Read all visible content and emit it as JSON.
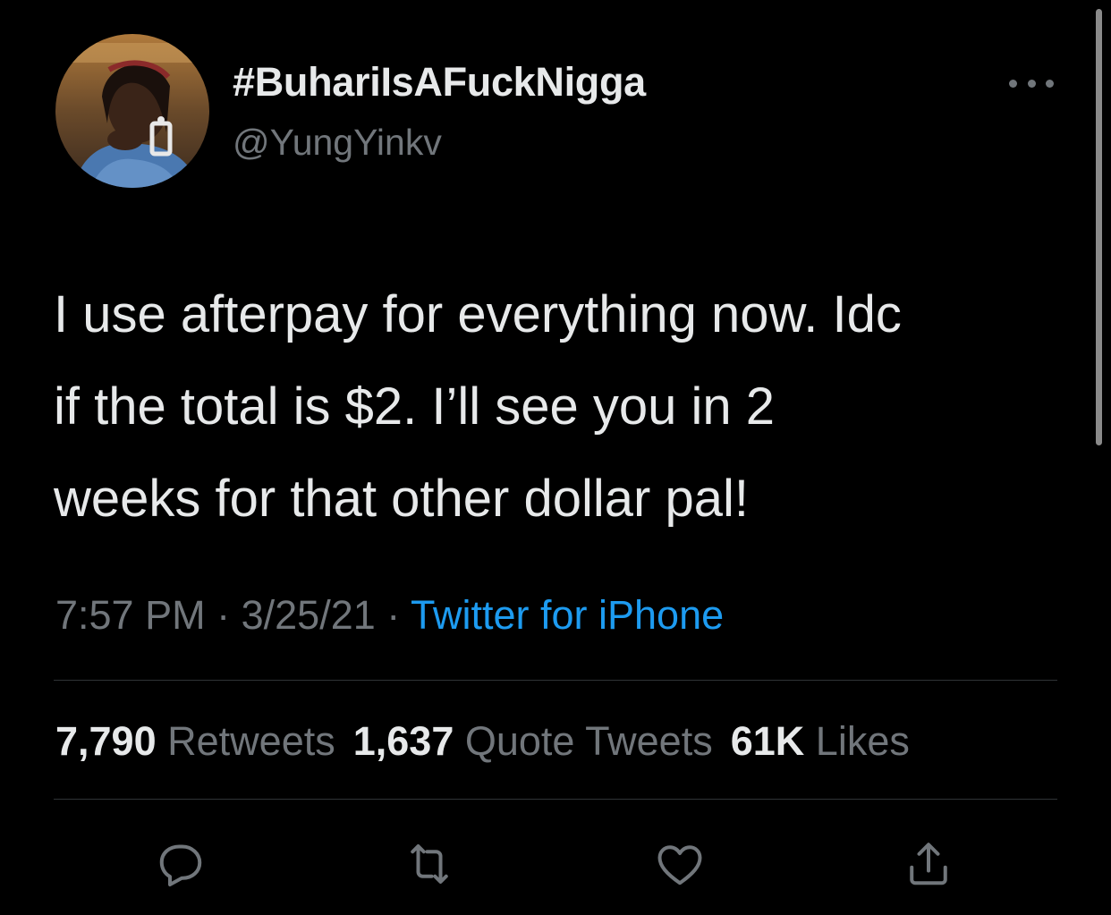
{
  "tweet": {
    "display_name": "#BuhariIsAFuckNigga",
    "handle": "@YungYinkv",
    "text_lines": [
      "I use afterpay for everything now. Idc",
      "if the total is $2. I’ll see you in 2",
      "weeks for that other dollar pal!"
    ],
    "time": "7:57 PM",
    "date": "3/25/21",
    "separator": "·",
    "source": "Twitter for iPhone",
    "stats": {
      "retweets_count": "7,790",
      "retweets_label": "Retweets",
      "quotes_count": "1,637",
      "quotes_label": "Quote Tweets",
      "likes_count": "61K",
      "likes_label": "Likes"
    }
  },
  "icons": {
    "more": "more-icon",
    "reply": "reply-icon",
    "retweet": "retweet-icon",
    "like": "heart-icon",
    "share": "share-icon"
  },
  "colors": {
    "background": "#000000",
    "text": "#e7e9ea",
    "secondary": "#71767b",
    "link": "#1d9bf0",
    "divider": "#2f3336"
  }
}
